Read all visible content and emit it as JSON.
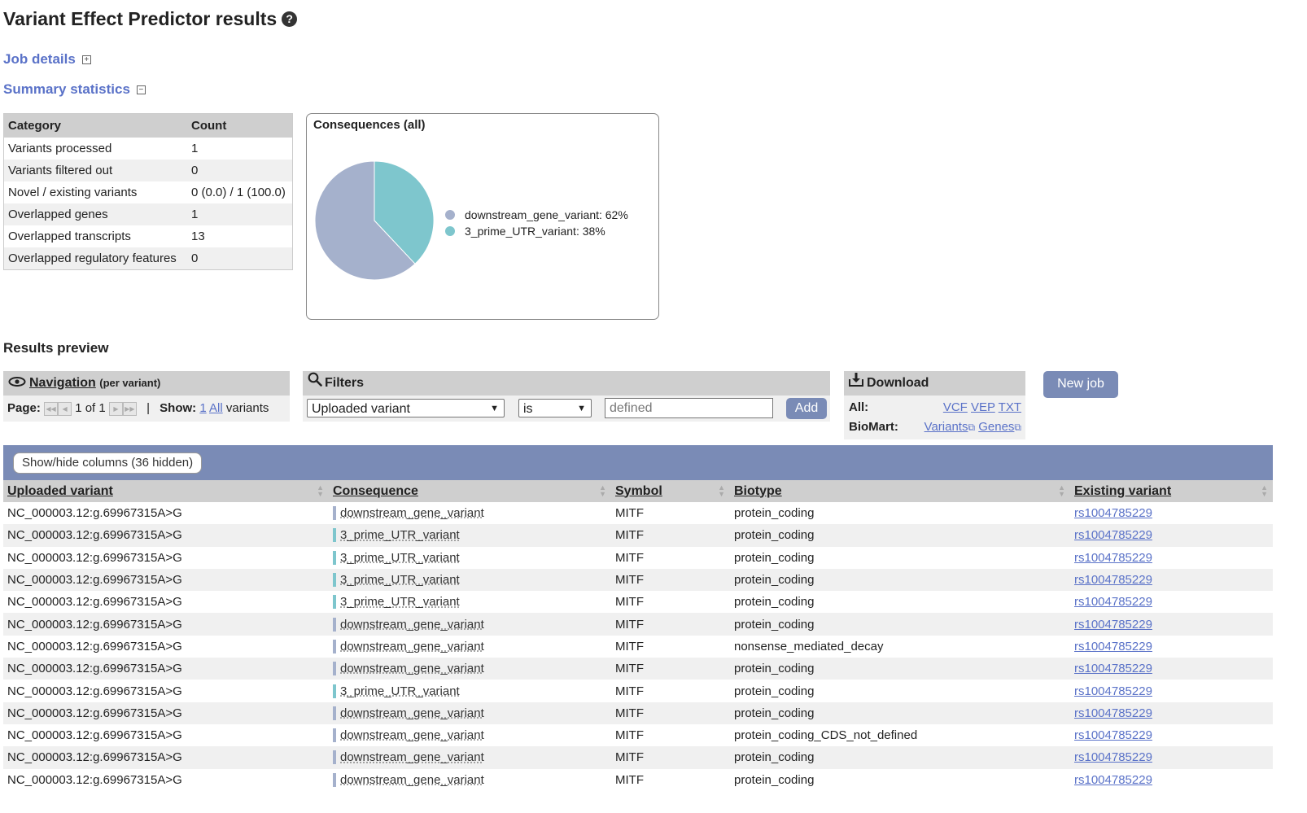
{
  "header": {
    "title": "Variant Effect Predictor results"
  },
  "sections": {
    "job_details": "Job details",
    "summary_statistics": "Summary statistics"
  },
  "summary": {
    "headers": [
      "Category",
      "Count"
    ],
    "rows": [
      [
        "Variants processed",
        "1"
      ],
      [
        "Variants filtered out",
        "0"
      ],
      [
        "Novel / existing variants",
        "0 (0.0) / 1 (100.0)"
      ],
      [
        "Overlapped genes",
        "1"
      ],
      [
        "Overlapped transcripts",
        "13"
      ],
      [
        "Overlapped regulatory features",
        "0"
      ]
    ]
  },
  "chart_data": {
    "type": "pie",
    "title": "Consequences (all)",
    "slices": [
      {
        "label": "downstream_gene_variant: 62%",
        "value": 62,
        "color": "#a5b1cc"
      },
      {
        "label": "3_prime_UTR_variant: 38%",
        "value": 38,
        "color": "#7ec6cd"
      }
    ]
  },
  "results_preview": {
    "heading": "Results preview"
  },
  "navigation": {
    "title": "Navigation",
    "subtitle": "(per variant)",
    "page_label": "Page:",
    "page_value": "1 of 1",
    "separator": "|",
    "show_label": "Show:",
    "show_one": "1",
    "show_all": "All",
    "show_suffix": "variants"
  },
  "filters": {
    "title": "Filters",
    "field_select": "Uploaded variant",
    "operator_select": "is",
    "value_placeholder": "defined",
    "add_button": "Add"
  },
  "download": {
    "title": "Download",
    "all_label": "All:",
    "all_links": [
      "VCF",
      "VEP",
      "TXT"
    ],
    "biomart_label": "BioMart:",
    "biomart_links": [
      "Variants",
      "Genes"
    ]
  },
  "new_job_button": "New job",
  "results": {
    "showhide_button": "Show/hide columns (36 hidden)",
    "columns": [
      "Uploaded variant",
      "Consequence",
      "Symbol",
      "Biotype",
      "Existing variant"
    ],
    "rows": [
      {
        "variant": "NC_000003.12:g.69967315A>G",
        "consequence": "downstream_gene_variant",
        "cons_color": "#a5b1cc",
        "symbol": "MITF",
        "biotype": "protein_coding",
        "existing": "rs1004785229"
      },
      {
        "variant": "NC_000003.12:g.69967315A>G",
        "consequence": "3_prime_UTR_variant",
        "cons_color": "#7ec6cd",
        "symbol": "MITF",
        "biotype": "protein_coding",
        "existing": "rs1004785229"
      },
      {
        "variant": "NC_000003.12:g.69967315A>G",
        "consequence": "3_prime_UTR_variant",
        "cons_color": "#7ec6cd",
        "symbol": "MITF",
        "biotype": "protein_coding",
        "existing": "rs1004785229"
      },
      {
        "variant": "NC_000003.12:g.69967315A>G",
        "consequence": "3_prime_UTR_variant",
        "cons_color": "#7ec6cd",
        "symbol": "MITF",
        "biotype": "protein_coding",
        "existing": "rs1004785229"
      },
      {
        "variant": "NC_000003.12:g.69967315A>G",
        "consequence": "3_prime_UTR_variant",
        "cons_color": "#7ec6cd",
        "symbol": "MITF",
        "biotype": "protein_coding",
        "existing": "rs1004785229"
      },
      {
        "variant": "NC_000003.12:g.69967315A>G",
        "consequence": "downstream_gene_variant",
        "cons_color": "#a5b1cc",
        "symbol": "MITF",
        "biotype": "protein_coding",
        "existing": "rs1004785229"
      },
      {
        "variant": "NC_000003.12:g.69967315A>G",
        "consequence": "downstream_gene_variant",
        "cons_color": "#a5b1cc",
        "symbol": "MITF",
        "biotype": "nonsense_mediated_decay",
        "existing": "rs1004785229"
      },
      {
        "variant": "NC_000003.12:g.69967315A>G",
        "consequence": "downstream_gene_variant",
        "cons_color": "#a5b1cc",
        "symbol": "MITF",
        "biotype": "protein_coding",
        "existing": "rs1004785229"
      },
      {
        "variant": "NC_000003.12:g.69967315A>G",
        "consequence": "3_prime_UTR_variant",
        "cons_color": "#7ec6cd",
        "symbol": "MITF",
        "biotype": "protein_coding",
        "existing": "rs1004785229"
      },
      {
        "variant": "NC_000003.12:g.69967315A>G",
        "consequence": "downstream_gene_variant",
        "cons_color": "#a5b1cc",
        "symbol": "MITF",
        "biotype": "protein_coding",
        "existing": "rs1004785229"
      },
      {
        "variant": "NC_000003.12:g.69967315A>G",
        "consequence": "downstream_gene_variant",
        "cons_color": "#a5b1cc",
        "symbol": "MITF",
        "biotype": "protein_coding_CDS_not_defined",
        "existing": "rs1004785229"
      },
      {
        "variant": "NC_000003.12:g.69967315A>G",
        "consequence": "downstream_gene_variant",
        "cons_color": "#a5b1cc",
        "symbol": "MITF",
        "biotype": "protein_coding",
        "existing": "rs1004785229"
      },
      {
        "variant": "NC_000003.12:g.69967315A>G",
        "consequence": "downstream_gene_variant",
        "cons_color": "#a5b1cc",
        "symbol": "MITF",
        "biotype": "protein_coding",
        "existing": "rs1004785229"
      }
    ]
  }
}
